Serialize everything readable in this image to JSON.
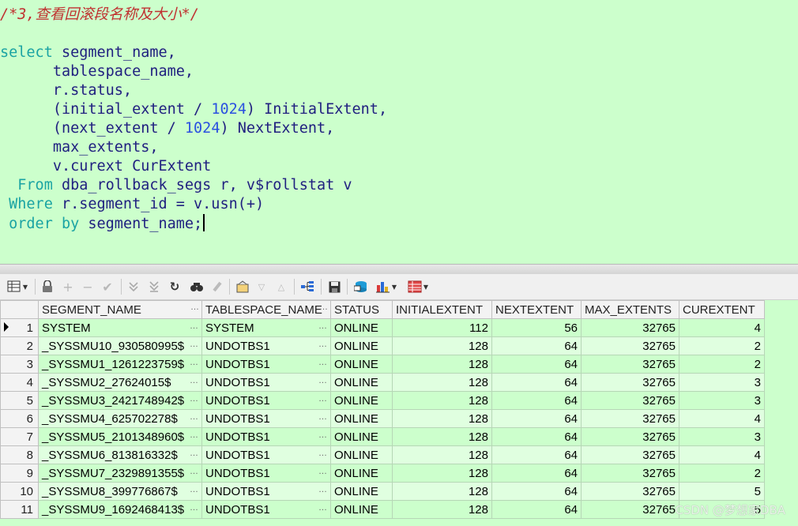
{
  "editor": {
    "comment": "/*3,查看回滚段名称及大小*/",
    "lines": [
      {
        "kw": "select",
        "rest": " segment_name,"
      },
      {
        "indent": "      ",
        "text": "tablespace_name,"
      },
      {
        "indent": "      ",
        "text": "r.status,"
      },
      {
        "indent": "      ",
        "pre": "(initial_extent / ",
        "num": "1024",
        "post": ") InitialExtent,"
      },
      {
        "indent": "      ",
        "pre": "(next_extent / ",
        "num": "1024",
        "post": ") NextExtent,"
      },
      {
        "indent": "      ",
        "text": "max_extents,"
      },
      {
        "indent": "      ",
        "text": "v.curext CurExtent"
      },
      {
        "kw": "  From",
        "rest": " dba_rollback_segs r, v$rollstat v"
      },
      {
        "kw": " Where",
        "rest": " r.segment_id = v.usn(+)"
      },
      {
        "kw": " order by",
        "rest": " segment_name;"
      }
    ]
  },
  "toolbar": {
    "icons": [
      "grid-menu-icon",
      "lock-icon",
      "add-record-icon",
      "delete-record-icon",
      "post-edit-icon",
      "next-record-icon",
      "last-record-icon",
      "refresh-icon",
      "find-icon",
      "clear-icon",
      "query-by-example-icon",
      "query-down-icon",
      "query-up-icon",
      "tree-view-icon",
      "save-icon",
      "export-icon",
      "chart-icon",
      "table-export-icon"
    ]
  },
  "grid": {
    "columns": [
      "SEGMENT_NAME",
      "TABLESPACE_NAME",
      "STATUS",
      "INITIALEXTENT",
      "NEXTEXTENT",
      "MAX_EXTENTS",
      "CUREXTENT"
    ],
    "rows": [
      [
        "1",
        "SYSTEM",
        "SYSTEM",
        "ONLINE",
        "112",
        "56",
        "32765",
        "4"
      ],
      [
        "2",
        "_SYSSMU10_930580995$",
        "UNDOTBS1",
        "ONLINE",
        "128",
        "64",
        "32765",
        "2"
      ],
      [
        "3",
        "_SYSSMU1_1261223759$",
        "UNDOTBS1",
        "ONLINE",
        "128",
        "64",
        "32765",
        "2"
      ],
      [
        "4",
        "_SYSSMU2_27624015$",
        "UNDOTBS1",
        "ONLINE",
        "128",
        "64",
        "32765",
        "3"
      ],
      [
        "5",
        "_SYSSMU3_2421748942$",
        "UNDOTBS1",
        "ONLINE",
        "128",
        "64",
        "32765",
        "3"
      ],
      [
        "6",
        "_SYSSMU4_625702278$",
        "UNDOTBS1",
        "ONLINE",
        "128",
        "64",
        "32765",
        "4"
      ],
      [
        "7",
        "_SYSSMU5_2101348960$",
        "UNDOTBS1",
        "ONLINE",
        "128",
        "64",
        "32765",
        "3"
      ],
      [
        "8",
        "_SYSSMU6_813816332$",
        "UNDOTBS1",
        "ONLINE",
        "128",
        "64",
        "32765",
        "4"
      ],
      [
        "9",
        "_SYSSMU7_2329891355$",
        "UNDOTBS1",
        "ONLINE",
        "128",
        "64",
        "32765",
        "2"
      ],
      [
        "10",
        "_SYSSMU8_399776867$",
        "UNDOTBS1",
        "ONLINE",
        "128",
        "64",
        "32765",
        "5"
      ],
      [
        "11",
        "_SYSSMU9_1692468413$",
        "UNDOTBS1",
        "ONLINE",
        "128",
        "64",
        "32765",
        "5"
      ]
    ]
  },
  "watermark": "CSDN @梦想家DBA",
  "colors": {
    "editor_bg": "#ccffcc",
    "keyword": "#1aa3a3",
    "identifier": "#202080",
    "number": "#2a50e0",
    "comment": "#c03030"
  }
}
